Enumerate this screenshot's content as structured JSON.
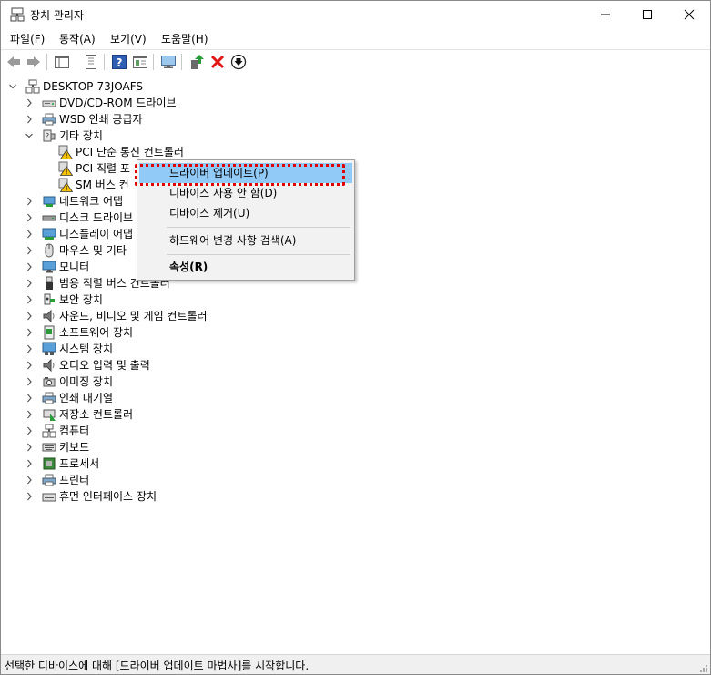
{
  "window": {
    "title": "장치 관리자",
    "controls": [
      "minimize",
      "maximize",
      "close"
    ]
  },
  "menubar": {
    "items": [
      "파일(F)",
      "동작(A)",
      "보기(V)",
      "도움말(H)"
    ]
  },
  "toolbar": {
    "buttons": [
      "back-icon",
      "forward-icon",
      "show-hide-tree-icon",
      "properties-icon",
      "help-icon",
      "view-icon",
      "monitor-icon",
      "update-driver-icon",
      "uninstall-icon",
      "download-icon"
    ]
  },
  "tree": {
    "root": "DESKTOP-73JOAFS",
    "categories": [
      {
        "label": "DVD/CD-ROM 드라이브",
        "icon": "dvd-icon"
      },
      {
        "label": "WSD 인쇄 공급자",
        "icon": "printer-icon"
      },
      {
        "label": "기타 장치",
        "icon": "unknown-device-icon",
        "expanded": true,
        "children": [
          {
            "label": "PCI 단순 통신 컨트롤러",
            "icon": "warning-device-icon"
          },
          {
            "label": "PCI 직렬 포",
            "icon": "warning-device-icon"
          },
          {
            "label": "SM 버스 컨",
            "icon": "warning-device-icon"
          }
        ]
      },
      {
        "label": "네트워크 어댑",
        "icon": "network-icon"
      },
      {
        "label": "디스크 드라이브",
        "icon": "disk-icon"
      },
      {
        "label": "디스플레이 어댑",
        "icon": "display-adapter-icon"
      },
      {
        "label": "마우스 및 기타",
        "icon": "mouse-icon"
      },
      {
        "label": "모니터",
        "icon": "monitor-icon"
      },
      {
        "label": "범용 직렬 버스 컨트롤러",
        "icon": "usb-icon"
      },
      {
        "label": "보안 장치",
        "icon": "security-icon"
      },
      {
        "label": "사운드, 비디오 및 게임 컨트롤러",
        "icon": "sound-icon"
      },
      {
        "label": "소프트웨어 장치",
        "icon": "software-icon"
      },
      {
        "label": "시스템 장치",
        "icon": "system-icon"
      },
      {
        "label": "오디오 입력 및 출력",
        "icon": "audio-icon"
      },
      {
        "label": "이미징 장치",
        "icon": "camera-icon"
      },
      {
        "label": "인쇄 대기열",
        "icon": "print-queue-icon"
      },
      {
        "label": "저장소 컨트롤러",
        "icon": "storage-icon"
      },
      {
        "label": "컴퓨터",
        "icon": "computer-icon"
      },
      {
        "label": "키보드",
        "icon": "keyboard-icon"
      },
      {
        "label": "프로세서",
        "icon": "processor-icon"
      },
      {
        "label": "프린터",
        "icon": "printer-icon"
      },
      {
        "label": "휴먼 인터페이스 장치",
        "icon": "hid-icon"
      }
    ]
  },
  "context_menu": {
    "items": [
      {
        "label": "드라이버 업데이트(P)",
        "highlighted": true
      },
      {
        "label": "디바이스 사용 안 함(D)"
      },
      {
        "label": "디바이스 제거(U)"
      },
      {
        "label": "하드웨어 변경 사항 검색(A)"
      },
      {
        "label": "속성(R)",
        "bold": true
      }
    ]
  },
  "status": {
    "text": "선택한 디바이스에 대해 [드라이버 업데이트 마법사]를 시작합니다."
  },
  "colors": {
    "highlight": "#91c9f7",
    "annotation": "#e00000",
    "status_bg": "#f0f0f0"
  }
}
